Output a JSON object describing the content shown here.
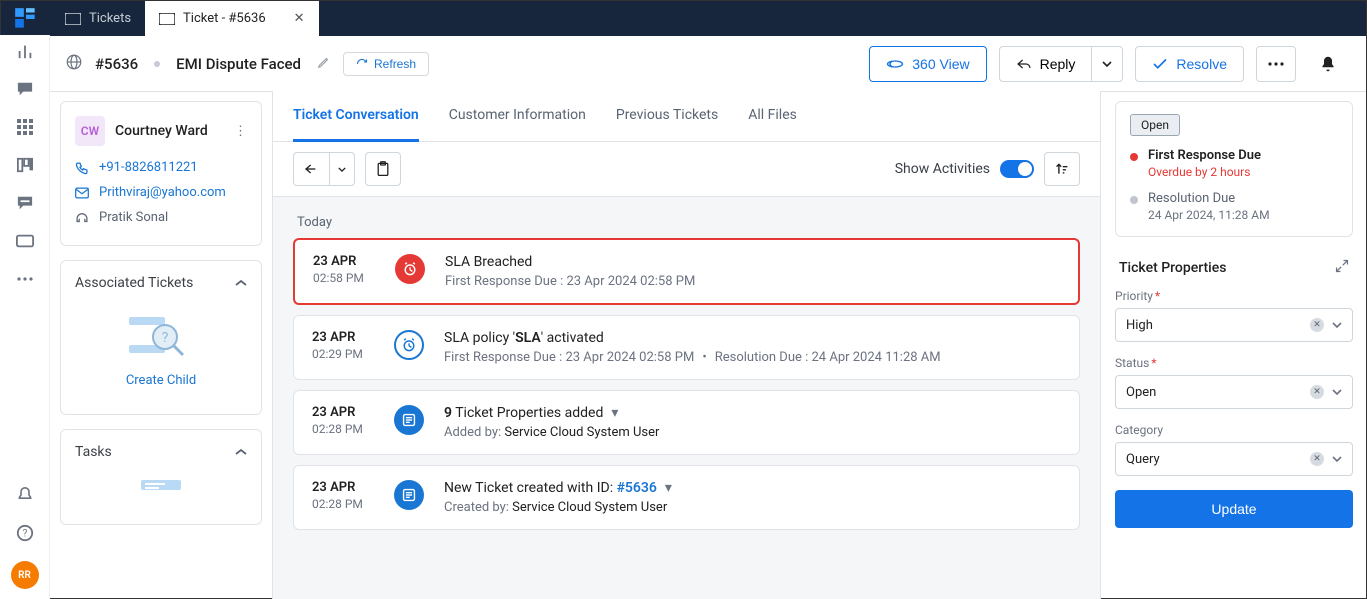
{
  "tabs": {
    "tickets": "Tickets",
    "ticket": "Ticket - #5636"
  },
  "header": {
    "id": "#5636",
    "title": "EMI Dispute Faced",
    "refresh": "Refresh",
    "view360": "360 View",
    "reply": "Reply",
    "resolve": "Resolve"
  },
  "rail_avatar": "RR",
  "contact": {
    "initials": "CW",
    "name": "Courtney Ward",
    "phone": "+91-8826811221",
    "email": "Prithviraj@yahoo.com",
    "agent": "Pratik Sonal"
  },
  "sections": {
    "associated": "Associated Tickets",
    "create_child": "Create Child",
    "tasks": "Tasks"
  },
  "center_tabs": {
    "conversation": "Ticket Conversation",
    "customer": "Customer Information",
    "previous": "Previous Tickets",
    "files": "All Files"
  },
  "show_activities": "Show Activities",
  "timeline": {
    "day": "Today",
    "items": [
      {
        "date": "23 APR",
        "time": "02:58 PM",
        "title": "SLA Breached",
        "sub_label": "First Response Due : ",
        "sub_value": "23 Apr 2024 02:58 PM",
        "icon": "red-alarm",
        "breached": true
      },
      {
        "date": "23 APR",
        "time": "02:29 PM",
        "title_pre": "SLA policy '",
        "title_bold": "SLA",
        "title_post": "' activated",
        "sub_label1": "First Response Due : ",
        "sub_value1": "23 Apr 2024 02:58 PM",
        "sub_label2": "Resolution Due : ",
        "sub_value2": "24 Apr 2024 11:28 AM",
        "icon": "blue-alarm"
      },
      {
        "date": "23 APR",
        "time": "02:28 PM",
        "title_bold": "9",
        "title_post": " Ticket Properties added",
        "sub_label": "Added by: ",
        "sub_value": "Service Cloud System User",
        "icon": "blue-list",
        "chevron": true
      },
      {
        "date": "23 APR",
        "time": "02:28 PM",
        "title_pre": "New Ticket created with ID: ",
        "title_link": "#5636",
        "sub_label": "Created by: ",
        "sub_value": "Service Cloud System User",
        "icon": "blue-list",
        "chevron": true
      }
    ]
  },
  "sla": {
    "open": "Open",
    "r1_title": "First Response Due",
    "r1_sub": "Overdue by 2 hours",
    "r2_title": "Resolution Due",
    "r2_sub": "24 Apr 2024, 11:28 AM"
  },
  "props": {
    "heading": "Ticket Properties",
    "priority_label": "Priority",
    "priority_value": "High",
    "status_label": "Status",
    "status_value": "Open",
    "category_label": "Category",
    "category_value": "Query",
    "update": "Update"
  }
}
